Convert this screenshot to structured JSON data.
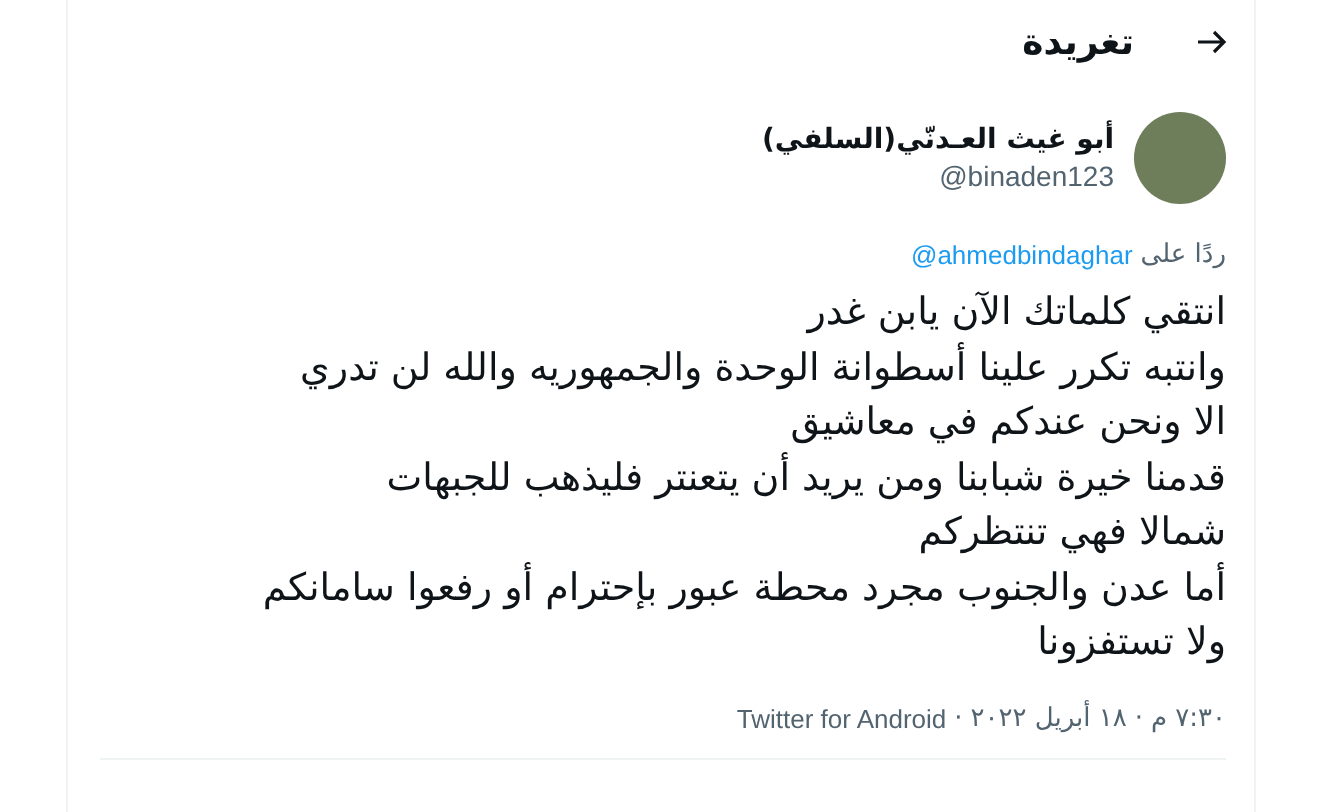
{
  "header": {
    "title": "تغريدة"
  },
  "tweet": {
    "author_name": "أبو غيث العـدنّي(السلفي)",
    "handle": "@binaden123",
    "reply_prefix": "ردًا على",
    "reply_to": "@ahmedbindaghar",
    "text": "انتقي كلماتك الآن يابن غدر\nوانتبه تكرر علينا أسطوانة الوحدة والجمهوريه والله لن تدري\nالا ونحن عندكم في معاشيق\nقدمنا خيرة شبابنا ومن يريد أن يتعنتر فليذهب للجبهات\nشمالا فهي تنتظركم\nأما عدن والجنوب مجرد محطة عبور بإحترام أو رفعوا سامانكم\nولا تستفزونا",
    "time": "٧:٣٠ م",
    "date": "١٨ أبريل ٢٠٢٢",
    "source": "Twitter for Android",
    "separator": "·"
  }
}
